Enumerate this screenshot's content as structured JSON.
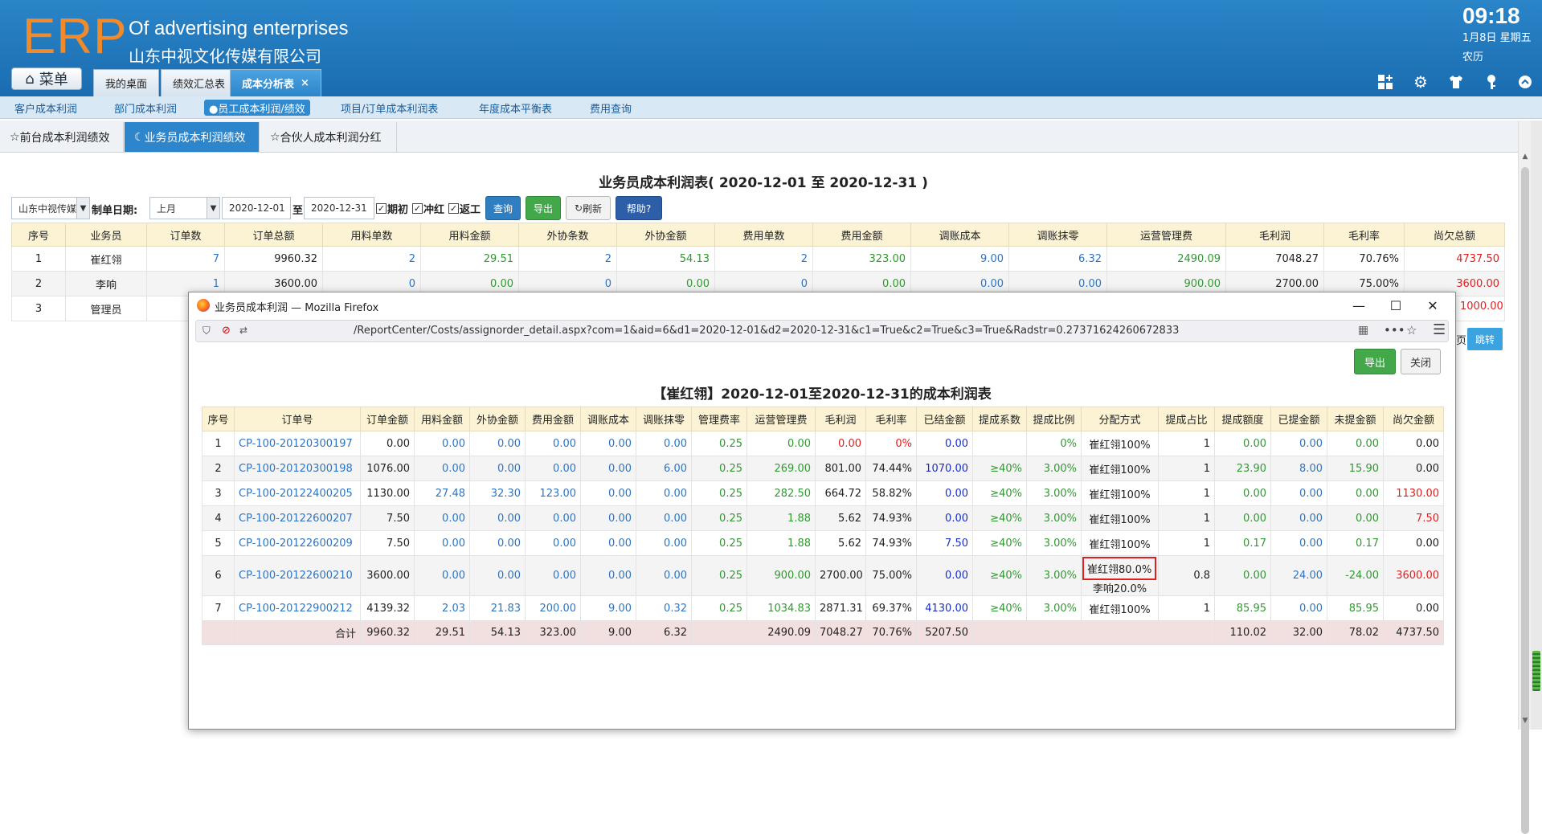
{
  "header": {
    "logo": "ERP",
    "app_title": "Of advertising enterprises",
    "company": "山东中视文化传媒有限公司",
    "time": "09:18",
    "date": "1月8日 星期五",
    "lunar": "农历",
    "menu_label": "菜单",
    "tabs": [
      {
        "label": "我的桌面"
      },
      {
        "label": "绩效汇总表"
      },
      {
        "label": "成本分析表"
      }
    ],
    "icons": [
      "add-panel-icon",
      "gear-icon",
      "shirt-icon",
      "key-icon",
      "collapse-icon"
    ]
  },
  "subnav": {
    "items": [
      {
        "label": "客户成本利润"
      },
      {
        "label": "部门成本利润"
      },
      {
        "label": "●员工成本利润/绩效"
      },
      {
        "label": "项目/订单成本利润表"
      },
      {
        "label": "年度成本平衡表"
      },
      {
        "label": "费用查询"
      }
    ]
  },
  "report_tabs": [
    {
      "label": "前台成本利润绩效"
    },
    {
      "label": "业务员成本利润绩效"
    },
    {
      "label": "合伙人成本利润分红"
    }
  ],
  "report": {
    "title": "业务员成本利润表( 2020-12-01 至 2020-12-31 )",
    "filter": {
      "company_select": "山东中视传媒",
      "date_label": "制单日期:",
      "period_select": "上月",
      "date_from": "2020-12-01",
      "to_label": "至",
      "date_to": "2020-12-31",
      "checks": [
        "期初",
        "冲红",
        "返工"
      ],
      "query_btn": "查询",
      "export_btn": "导出",
      "refresh_btn": "刷新",
      "help_btn": "帮助?"
    },
    "columns": [
      "序号",
      "业务员",
      "订单数",
      "订单总额",
      "用料单数",
      "用料金额",
      "外协条数",
      "外协金额",
      "费用单数",
      "费用金额",
      "调账成本",
      "调账抹零",
      "运营管理费",
      "毛利润",
      "毛利率",
      "尚欠总额"
    ],
    "rows": [
      [
        "1",
        "崔红翎",
        "7",
        "9960.32",
        "2",
        "29.51",
        "2",
        "54.13",
        "2",
        "323.00",
        "9.00",
        "6.32",
        "2490.09",
        "7048.27",
        "70.76%",
        "4737.50"
      ],
      [
        "2",
        "李响",
        "1",
        "3600.00",
        "0",
        "0.00",
        "0",
        "0.00",
        "0",
        "0.00",
        "0.00",
        "0.00",
        "900.00",
        "2700.00",
        "75.00%",
        "3600.00"
      ],
      [
        "3",
        "管理员"
      ]
    ],
    "row3_owed_tail": "1000.00",
    "page_label": "页",
    "jump_btn": "跳转"
  },
  "popup": {
    "window_title": "业务员成本利润 — Mozilla Firefox",
    "url": "/ReportCenter/Costs/assignorder_detail.aspx?com=1&aid=6&d1=2020-12-01&d2=2020-12-31&c1=True&c2=True&c3=True&Radstr=0.27371624260672833",
    "export_btn": "导出",
    "close_btn": "关闭",
    "title": "【崔红翎】2020-12-01至2020-12-31的成本利润表",
    "columns": [
      "序号",
      "订单号",
      "订单金额",
      "用料金额",
      "外协金额",
      "费用金额",
      "调账成本",
      "调账抹零",
      "管理费率",
      "运营管理费",
      "毛利润",
      "毛利率",
      "已结金额",
      "提成系数",
      "提成比例",
      "分配方式",
      "提成占比",
      "提成额度",
      "已提金额",
      "未提金额",
      "尚欠金额"
    ],
    "rows": [
      [
        "1",
        "CP-100-20120300197",
        "0.00",
        "0.00",
        "0.00",
        "0.00",
        "0.00",
        "0.00",
        "0.25",
        "0.00",
        "0.00",
        "0%",
        "0.00",
        "",
        "0%",
        "崔红翎100%",
        "1",
        "0.00",
        "0.00",
        "0.00",
        "0.00"
      ],
      [
        "2",
        "CP-100-20120300198",
        "1076.00",
        "0.00",
        "0.00",
        "0.00",
        "0.00",
        "6.00",
        "0.25",
        "269.00",
        "801.00",
        "74.44%",
        "1070.00",
        "≥40%",
        "3.00%",
        "崔红翎100%",
        "1",
        "23.90",
        "8.00",
        "15.90",
        "0.00"
      ],
      [
        "3",
        "CP-100-20122400205",
        "1130.00",
        "27.48",
        "32.30",
        "123.00",
        "0.00",
        "0.00",
        "0.25",
        "282.50",
        "664.72",
        "58.82%",
        "0.00",
        "≥40%",
        "3.00%",
        "崔红翎100%",
        "1",
        "0.00",
        "0.00",
        "0.00",
        "1130.00"
      ],
      [
        "4",
        "CP-100-20122600207",
        "7.50",
        "0.00",
        "0.00",
        "0.00",
        "0.00",
        "0.00",
        "0.25",
        "1.88",
        "5.62",
        "74.93%",
        "0.00",
        "≥40%",
        "3.00%",
        "崔红翎100%",
        "1",
        "0.00",
        "0.00",
        "0.00",
        "7.50"
      ],
      [
        "5",
        "CP-100-20122600209",
        "7.50",
        "0.00",
        "0.00",
        "0.00",
        "0.00",
        "0.00",
        "0.25",
        "1.88",
        "5.62",
        "74.93%",
        "7.50",
        "≥40%",
        "3.00%",
        "崔红翎100%",
        "1",
        "0.17",
        "0.00",
        "0.17",
        "0.00"
      ],
      [
        "6",
        "CP-100-20122600210",
        "3600.00",
        "0.00",
        "0.00",
        "0.00",
        "0.00",
        "0.00",
        "0.25",
        "900.00",
        "2700.00",
        "75.00%",
        "0.00",
        "≥40%",
        "3.00%",
        "崔红翎80.0%",
        "0.8",
        "0.00",
        "24.00",
        "-24.00",
        "3600.00"
      ],
      [
        "7",
        "CP-100-20122900212",
        "4139.32",
        "2.03",
        "21.83",
        "200.00",
        "9.00",
        "0.32",
        "0.25",
        "1034.83",
        "2871.31",
        "69.37%",
        "4130.00",
        "≥40%",
        "3.00%",
        "崔红翎100%",
        "1",
        "85.95",
        "0.00",
        "85.95",
        "0.00"
      ]
    ],
    "row6_alloc_second": "李响20.0%",
    "total": {
      "label": "合计",
      "values": [
        "9960.32",
        "29.51",
        "54.13",
        "323.00",
        "9.00",
        "6.32",
        "",
        "2490.09",
        "7048.27",
        "70.76%",
        "5207.50",
        "",
        "",
        "",
        "",
        "110.02",
        "32.00",
        "78.02",
        "4737.50"
      ]
    }
  }
}
